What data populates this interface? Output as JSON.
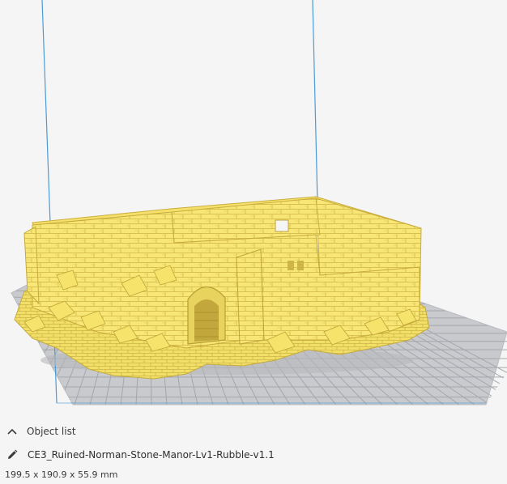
{
  "object_panel": {
    "object_list_label": "Object list",
    "object_name": "CE3_Ruined-Norman-Stone-Manor-Lv1-Rubble-v1.1",
    "dimensions": "199.5 x 190.9 x 55.9 mm"
  },
  "icons": {
    "collapse": "chevron-up-icon",
    "edit": "pencil-icon"
  },
  "colors": {
    "model": "#f7e571",
    "build_plate": "#c8c9cc",
    "grid_line": "#9fa2a8",
    "build_volume_edge": "#4c9bd6",
    "background": "#f5f5f6"
  }
}
